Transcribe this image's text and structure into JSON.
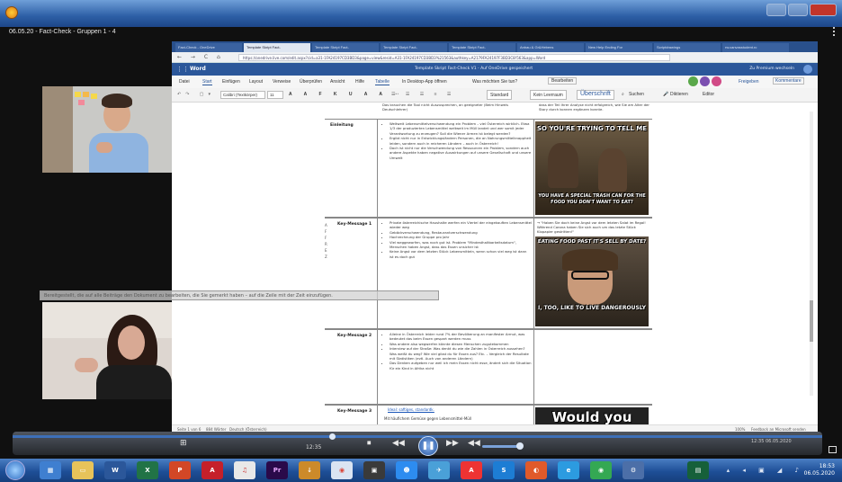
{
  "meeting": {
    "title": "06.05.20 - Fact-Check - Gruppen 1 - 4"
  },
  "browser": {
    "tabs": [
      "Fact-Check - OneDrive",
      "Template Skript Fact-",
      "Template Skript Fact-",
      "Template Skript Fact-",
      "Template Skript Fact-",
      "Anbau & Gr&Hebens",
      "New Help Ending For",
      "Scriptdrawings",
      "rw.canvasstudent.rc"
    ],
    "url": "https://onedrive.live.com/edit.aspx?cid=a31-1FA24197CD3BD3&page=view&resid=A31-1FA24197CD3BD3%21563&authkey=A2179FA24197F3BD3C8!563&app=Word",
    "nav_icons": "← → C ⌂"
  },
  "word": {
    "app_name": "Word",
    "doc_title": "Template Skript Fact-Check V1 - Auf OneDrive gespeichert",
    "premium": "Zu Premium wechseln",
    "ribbon_tabs": [
      "Datei",
      "Start",
      "Einfügen",
      "Layout",
      "Verweise",
      "Überprüfen",
      "Ansicht",
      "Hilfe",
      "Tabelle",
      "In Desktop-App öffnen",
      "Was möchten Sie tun?",
      "Bearbeiten"
    ],
    "font": "Calibri (Textkörper)",
    "font_size": "11",
    "styles": [
      "Standard",
      "Kein Leerraum",
      "Überschrift"
    ],
    "ribbon_right": [
      "Suchen",
      "Diktieren",
      "Editor"
    ],
    "share": [
      "Freigeben",
      "Kommentare"
    ],
    "status": [
      "Seite 1 von 6",
      "884 Wörter",
      "Deutsch (Österreich)"
    ],
    "status_right": [
      "100%",
      "Feedback an Microsoft senden"
    ]
  },
  "document": {
    "top_text": "Das brauchen die Tool nicht Auszusprechen, an geeigneter (Beim Hinweis Deutschlehrer)",
    "top_right": "dass der Teil Ihrer Analyse nicht erfolgreich, wie Sie am Alter der Story durch konnen ergänzen konnte.",
    "rows": [
      {
        "label": "Einleitung",
        "bullets": [
          "Weltweit Lebensmittelverschwendung ein Problem – viel Österreich wirklich. Etwa 1/3 der produzierten Lebensmittel weltweit im Müll landet und wer somit jeder Verantwortung zu erzeugen? Soll die Wiener Armen ist belegt werden?",
          "Ergibt nicht nur in Entwicklungsländern Personen, die an Nahrungsmittelknappheit leiden, sondern auch in reicheren Ländern – auch in Österreich!",
          "Doch ist nicht nur die Verschwendung von Ressourcen ein Problem, sondern auch andere Aspekte haben negative Auswirkungen auf unsere Gesellschaft und unsere Umwelt"
        ],
        "meme_top": "SO YOU'RE TRYING TO TELL ME",
        "meme_bottom": "YOU HAVE A SPECIAL TRASH CAN FOR THE FOOD YOU DON'T WANT TO EAT?"
      },
      {
        "label": "Key-Message 1",
        "bullets": [
          "Private österreichische Haushalte werfen ein Viertel der eingekauften Lebensmittel wieder weg",
          "Gebäckverschwendung, Restaurantverschwendung",
          "Hochrechnung der Gruppe pro Jahr",
          "Viel weggeworfen, was noch gut ist. Problem \"Mindesthaltbarkeitsdatum\", Menschen haben Angst, dass das Essen unsicher ist",
          "Keine Angst vor dem letzten Stück Lebensmitteln, wenn schon viel weg ist dann ist es doch gut"
        ],
        "right_text": "→ \"Haben Sie doch keine Angst vor dem letzten Salat im Regal! Während Corona haben Sie sich auch um das letzte Stück Klopapier gestritten!\"",
        "meme_top": "EATING FOOD PAST IT'S SELL BY DATE?",
        "meme_bottom": "I, TOO, LIKE TO LIVE DANGEROUSLY"
      },
      {
        "label": "Key-Message 2",
        "bullets": [
          "Alleine in Österreich leider rund 7% der Bevölkerung an manifester Armut, was bedeutet das beim Essen gespart werden muss",
          "Was andere also wegwerfen könnte diesen Menschen zugutekommen",
          "Interview auf der Straße: Was denkt du wie die Zahlen in Österreich aussehen? Was weißt du weg? Wie viel gibst du für Essen aus? Etc. – Vergleich der Resultate mit Statistiken (evtl. Auch von anderen Ländern)",
          "Das Denken aufgeben nur weil ich mein Essen nicht esse, ändert sich die Situation für ein Kind in Afrika nicht"
        ]
      },
      {
        "label": "Key-Message 3",
        "link": "Ideal: saftiges, standardk.",
        "text2": "Mit häufichem Gemüse gegen Lebensmittel-Müll",
        "meme_top": "Would you"
      }
    ],
    "side_letters": [
      "A",
      "F",
      "F",
      "R",
      "E",
      "Z"
    ]
  },
  "overlay_hint": "Bereitgestellt, die auf alle Beiträge den Dokument zu bearbeiten, die Sie gemerkt haben – auf die Zeile mit der Zeit einzufügen.",
  "player": {
    "time": "12:35",
    "controls": [
      "⏮",
      "⏹",
      "◀◀",
      "▶▶",
      "◀◀"
    ],
    "play": "❚❚",
    "tray_time": "12:35 06.05.2020"
  },
  "taskbar": {
    "apps": [
      "explorer",
      "outlook",
      "word",
      "excel",
      "powerpoint",
      "acrobat",
      "itunes",
      "premiere",
      "download",
      "chrome",
      "zoom",
      "people",
      "maps",
      "acrobat2",
      "lync",
      "ie",
      "chrome2",
      "settings"
    ],
    "clock_time": "18:53",
    "clock_date": "06.05.2020"
  },
  "colors": {
    "word_blue": "#2b579a",
    "taskbar_blue": "#1e4f97"
  }
}
